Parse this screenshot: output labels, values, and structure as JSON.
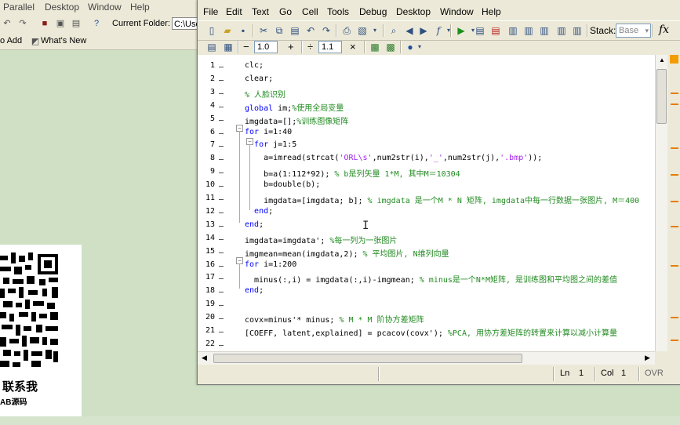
{
  "background_app": {
    "menu": [
      "Parallel",
      "Desktop",
      "Window",
      "Help"
    ],
    "current_folder_label": "Current Folder:",
    "current_folder_value": "C:\\Use",
    "shortcut_add": "o Add",
    "shortcut_whats_new": "What's New",
    "qr_caption_line1": "联系我",
    "qr_caption_line2": "AB源码"
  },
  "editor": {
    "menu": [
      "File",
      "Edit",
      "Text",
      "Go",
      "Cell",
      "Tools",
      "Debug",
      "Desktop",
      "Window",
      "Help"
    ],
    "stack_label": "Stack:",
    "stack_value": "Base",
    "fx_label": "fx",
    "cell_minus": "−",
    "cell_step": "1.0",
    "cell_plus": "+",
    "cell_divide": "÷",
    "cell_factor": "1.1",
    "cell_times": "×",
    "lines": [
      {
        "n": "1",
        "code": "clc;"
      },
      {
        "n": "2",
        "code": "clear;"
      },
      {
        "n": "3",
        "code": "% 人脸识别"
      },
      {
        "n": "4",
        "code": "global im;%使用全局变量"
      },
      {
        "n": "5",
        "code": "imgdata=[];%训练图像矩阵"
      },
      {
        "n": "6",
        "code": "for i=1:40"
      },
      {
        "n": "7",
        "code": "  for j=1:5"
      },
      {
        "n": "8",
        "code": "    a=imread(strcat('ORL\\s',num2str(i),'_',num2str(j),'.bmp'));"
      },
      {
        "n": "9",
        "code": "    b=a(1:112*92); % b是列矢量 1*M, 其中M＝10304"
      },
      {
        "n": "10",
        "code": "    b=double(b);"
      },
      {
        "n": "11",
        "code": "    imgdata=[imgdata; b]; % imgdata 是一个M * N 矩阵, imgdata中每一行数据一张图片, M＝400"
      },
      {
        "n": "12",
        "code": "  end;"
      },
      {
        "n": "13",
        "code": "end;"
      },
      {
        "n": "14",
        "code": "imgdata=imgdata'; %每一列为一张图片"
      },
      {
        "n": "15",
        "code": "imgmean=mean(imgdata,2); % 平均图片, N维列向量"
      },
      {
        "n": "16",
        "code": "for i=1:200"
      },
      {
        "n": "17",
        "code": "  minus(:,i) = imgdata(:,i)-imgmean; % minus是一个N*M矩阵, 是训练图和平均图之间的差值"
      },
      {
        "n": "18",
        "code": "end;"
      },
      {
        "n": "19",
        "code": ""
      },
      {
        "n": "20",
        "code": "covx=minus'* minus; % M * M 阶协方差矩阵"
      },
      {
        "n": "21",
        "code": "[COEFF, latent,explained] = pcacov(covx'); %PCA, 用协方差矩阵的转置来计算以减小计算量"
      },
      {
        "n": "22",
        "code": ""
      }
    ],
    "status": {
      "ln_label": "Ln",
      "ln_value": "1",
      "col_label": "Col",
      "col_value": "1",
      "ovr": "OVR"
    }
  }
}
